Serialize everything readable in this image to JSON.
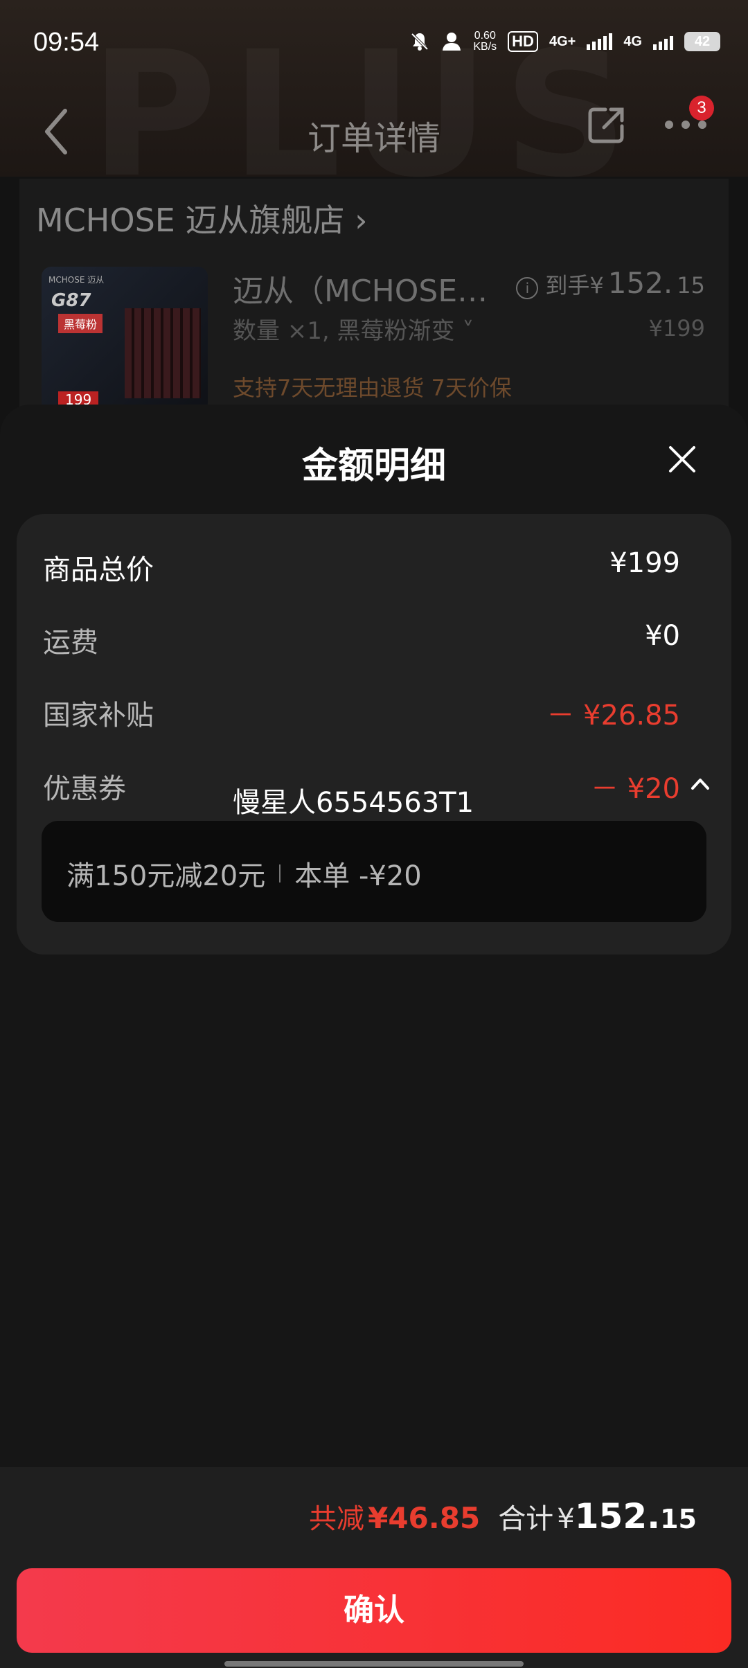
{
  "status_bar": {
    "time": "09:54",
    "net_speed": "0.60",
    "net_unit": "KB/s",
    "hd": "HD",
    "net1": "4G+",
    "net2": "4G",
    "battery": "42"
  },
  "navbar": {
    "title": "订单详情",
    "badge_count": "3",
    "watermark": "PLUS"
  },
  "order": {
    "shop_name": "MCHOSE 迈从旗舰店",
    "product_title": "迈从（MCHOSE…",
    "spec": "数量 ×1, 黑莓粉渐变 ˅",
    "service": "支持7天无理由退货   7天价保",
    "final_label": "到手¥",
    "final_int": "152.",
    "final_dec": "15",
    "original_price": "¥199",
    "thumb_brand": "MCHOSE 迈从",
    "thumb_model": "G87",
    "thumb_tag": "黑莓粉",
    "thumb_price": "199"
  },
  "sheet": {
    "title": "金额明细",
    "rows": [
      {
        "label": "商品总价",
        "value": "¥199"
      },
      {
        "label": "运费",
        "value": "¥0"
      },
      {
        "label": "国家补贴",
        "value": "－ ¥26.85"
      },
      {
        "label": "优惠券",
        "value": "－ ¥20"
      }
    ],
    "overlay_text": "慢星人6554563T1",
    "coupon_condition": "满150元减20元",
    "coupon_applied": "本单 -¥20"
  },
  "footer": {
    "saved_label": "共减",
    "saved_value": "¥46.85",
    "total_label": "合计",
    "total_currency": "¥",
    "total_int": "152.",
    "total_dec": "15",
    "confirm": "确认"
  },
  "colors": {
    "accent_red": "#e93d2f",
    "button_start": "#f43a4c",
    "button_end": "#fb2b24",
    "sheet_bg": "#161616",
    "panel_bg": "#222222"
  }
}
